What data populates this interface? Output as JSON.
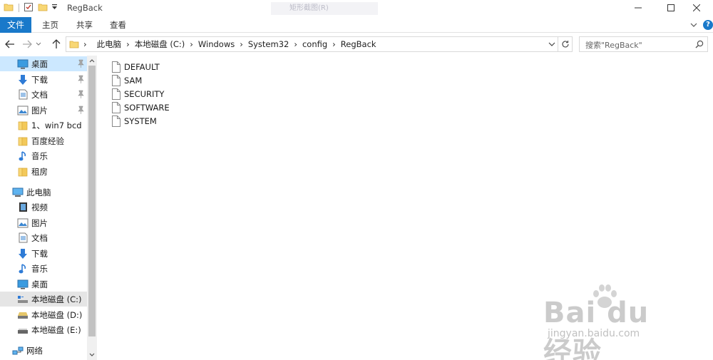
{
  "window": {
    "title": "RegBack",
    "ghost_text": "矩形截图(R)"
  },
  "ribbon": {
    "file_tab": "文件",
    "tabs": [
      "主页",
      "共享",
      "查看"
    ]
  },
  "address": {
    "crumbs": [
      "此电脑",
      "本地磁盘 (C:)",
      "Windows",
      "System32",
      "config",
      "RegBack"
    ]
  },
  "search": {
    "placeholder": "搜索\"RegBack\""
  },
  "sidebar": {
    "quick_access": [
      {
        "label": "桌面",
        "icon": "desktop-icon",
        "pinned": true
      },
      {
        "label": "下载",
        "icon": "download-icon",
        "pinned": true
      },
      {
        "label": "文档",
        "icon": "document-icon",
        "pinned": true
      },
      {
        "label": "图片",
        "icon": "picture-icon",
        "pinned": true
      },
      {
        "label": "1、win7 bcd",
        "icon": "folder-icon",
        "pinned": false
      },
      {
        "label": "百度经验",
        "icon": "folder-icon",
        "pinned": false
      },
      {
        "label": "音乐",
        "icon": "music-icon",
        "pinned": false
      },
      {
        "label": "租房",
        "icon": "folder-icon",
        "pinned": false
      }
    ],
    "this_pc": {
      "label": "此电脑",
      "icon": "computer-icon"
    },
    "pc_items": [
      {
        "label": "视频",
        "icon": "video-icon"
      },
      {
        "label": "图片",
        "icon": "picture-icon"
      },
      {
        "label": "文档",
        "icon": "document-icon"
      },
      {
        "label": "下载",
        "icon": "download-icon"
      },
      {
        "label": "音乐",
        "icon": "music-icon"
      },
      {
        "label": "桌面",
        "icon": "desktop-icon"
      },
      {
        "label": "本地磁盘 (C:)",
        "icon": "drive-c-icon"
      },
      {
        "label": "本地磁盘 (D:)",
        "icon": "drive-icon"
      },
      {
        "label": "本地磁盘 (E:)",
        "icon": "drive-icon"
      }
    ],
    "network": {
      "label": "网络",
      "icon": "network-icon"
    }
  },
  "files": [
    "DEFAULT",
    "SAM",
    "SECURITY",
    "SOFTWARE",
    "SYSTEM"
  ],
  "watermark": {
    "logo": "Bai du 经验",
    "url": "jingyan.baidu.com"
  },
  "colors": {
    "accent": "#1979ca",
    "selection": "#cce8ff",
    "hover": "#e5e5e5"
  }
}
